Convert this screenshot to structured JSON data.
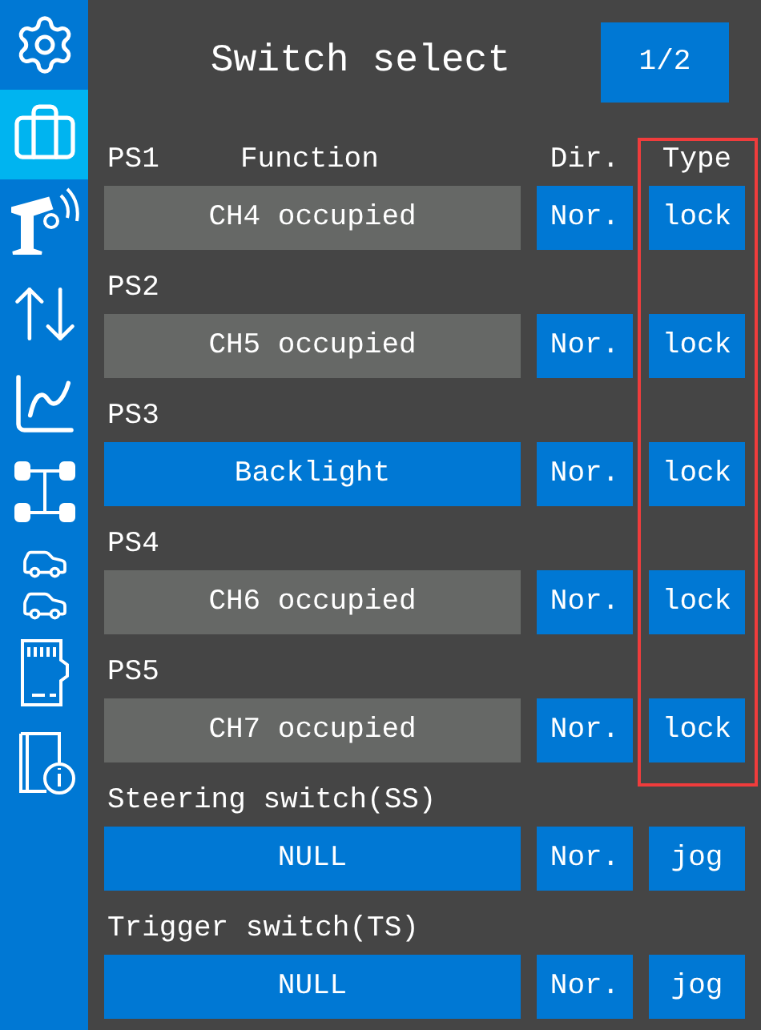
{
  "sidebar": {
    "items": [
      {
        "kind": "settings",
        "selected": false
      },
      {
        "kind": "toolbox",
        "selected": true
      },
      {
        "kind": "transmitter",
        "selected": false
      },
      {
        "kind": "updown",
        "selected": false
      },
      {
        "kind": "chart",
        "selected": false
      },
      {
        "kind": "chassis",
        "selected": false
      },
      {
        "kind": "cars",
        "selected": false
      },
      {
        "kind": "sdcard",
        "selected": false
      },
      {
        "kind": "info",
        "selected": false
      }
    ]
  },
  "header": {
    "title": "Switch select",
    "page": "1/2"
  },
  "column_headers": {
    "function": "Function",
    "dir": "Dir.",
    "type": "Type"
  },
  "type_column_highlighted": true,
  "switches": [
    {
      "label": "PS1",
      "function": "CH4 occupied",
      "occupied": true,
      "dir": "Nor.",
      "type": "lock"
    },
    {
      "label": "PS2",
      "function": "CH5 occupied",
      "occupied": true,
      "dir": "Nor.",
      "type": "lock"
    },
    {
      "label": "PS3",
      "function": "Backlight",
      "occupied": false,
      "dir": "Nor.",
      "type": "lock"
    },
    {
      "label": "PS4",
      "function": "CH6 occupied",
      "occupied": true,
      "dir": "Nor.",
      "type": "lock"
    },
    {
      "label": "PS5",
      "function": "CH7 occupied",
      "occupied": true,
      "dir": "Nor.",
      "type": "lock"
    },
    {
      "label": "Steering switch(SS)",
      "function": "NULL",
      "occupied": false,
      "dir": "Nor.",
      "type": "jog"
    },
    {
      "label": "Trigger switch(TS)",
      "function": "NULL",
      "occupied": false,
      "dir": "Nor.",
      "type": "jog"
    }
  ]
}
